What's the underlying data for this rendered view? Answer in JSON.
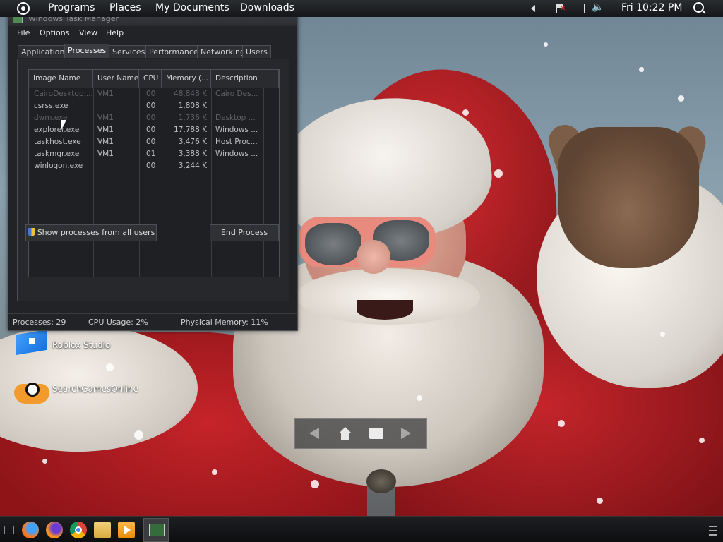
{
  "top_panel": {
    "menu": [
      "Programs",
      "Places",
      "My Documents",
      "Downloads"
    ],
    "clock": "Fri 10:22 PM"
  },
  "taskmgr": {
    "title": "Windows Task Manager",
    "menu": [
      "File",
      "Options",
      "View",
      "Help"
    ],
    "tabs": [
      "Applications",
      "Processes",
      "Services",
      "Performance",
      "Networking",
      "Users"
    ],
    "active_tab": "Processes",
    "columns": [
      "Image Name",
      "User Name",
      "CPU",
      "Memory (...",
      "Description"
    ],
    "rows": [
      {
        "name": "CairoDesktop....",
        "user": "VM1",
        "cpu": "00",
        "mem": "48,848 K",
        "desc": "Cairo Des..."
      },
      {
        "name": "csrss.exe",
        "user": "",
        "cpu": "00",
        "mem": "1,808 K",
        "desc": ""
      },
      {
        "name": "dwm.exe",
        "user": "VM1",
        "cpu": "00",
        "mem": "1,736 K",
        "desc": "Desktop ..."
      },
      {
        "name": "explorer.exe",
        "user": "VM1",
        "cpu": "00",
        "mem": "17,788 K",
        "desc": "Windows ..."
      },
      {
        "name": "taskhost.exe",
        "user": "VM1",
        "cpu": "00",
        "mem": "3,476 K",
        "desc": "Host Proc..."
      },
      {
        "name": "taskmgr.exe",
        "user": "VM1",
        "cpu": "01",
        "mem": "3,388 K",
        "desc": "Windows ..."
      },
      {
        "name": "winlogon.exe",
        "user": "",
        "cpu": "00",
        "mem": "3,244 K",
        "desc": ""
      }
    ],
    "show_all_label": "Show processes from all users",
    "end_process_label": "End Process",
    "status": {
      "processes": "Processes: 29",
      "cpu": "CPU Usage: 2%",
      "memory": "Physical Memory: 11%"
    }
  },
  "desktop_icons": [
    {
      "label": "Roblox Studio",
      "icon": "roblox-icon"
    },
    {
      "label": "SearchGamesOnline",
      "icon": "gamepad-icon"
    }
  ],
  "taskbar": {
    "apps": [
      "firefox-icon",
      "firefox-alt-icon",
      "chrome-icon",
      "files-icon",
      "media-icon",
      "task-manager-icon"
    ]
  }
}
